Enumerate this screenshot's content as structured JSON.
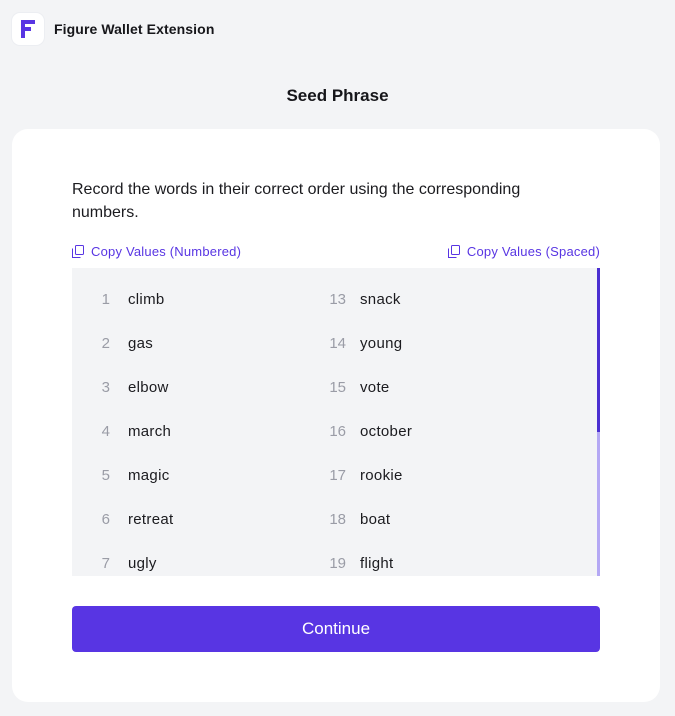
{
  "header": {
    "app_title": "Figure Wallet Extension",
    "logo_icon": "figure-logo-icon",
    "brand_color": "#5835e3"
  },
  "page": {
    "title": "Seed Phrase",
    "instructions": "Record the words in their correct order using the corresponding numbers."
  },
  "copy": {
    "numbered_label": "Copy Values (Numbered)",
    "spaced_label": "Copy Values (Spaced)",
    "icon": "copy-icon"
  },
  "words": {
    "left": [
      {
        "num": "1",
        "word": "climb"
      },
      {
        "num": "2",
        "word": "gas"
      },
      {
        "num": "3",
        "word": "elbow"
      },
      {
        "num": "4",
        "word": "march"
      },
      {
        "num": "5",
        "word": "magic"
      },
      {
        "num": "6",
        "word": "retreat"
      },
      {
        "num": "7",
        "word": "ugly"
      }
    ],
    "right": [
      {
        "num": "13",
        "word": "snack"
      },
      {
        "num": "14",
        "word": "young"
      },
      {
        "num": "15",
        "word": "vote"
      },
      {
        "num": "16",
        "word": "october"
      },
      {
        "num": "17",
        "word": "rookie"
      },
      {
        "num": "18",
        "word": "boat"
      },
      {
        "num": "19",
        "word": "flight"
      }
    ]
  },
  "actions": {
    "continue_label": "Continue"
  }
}
